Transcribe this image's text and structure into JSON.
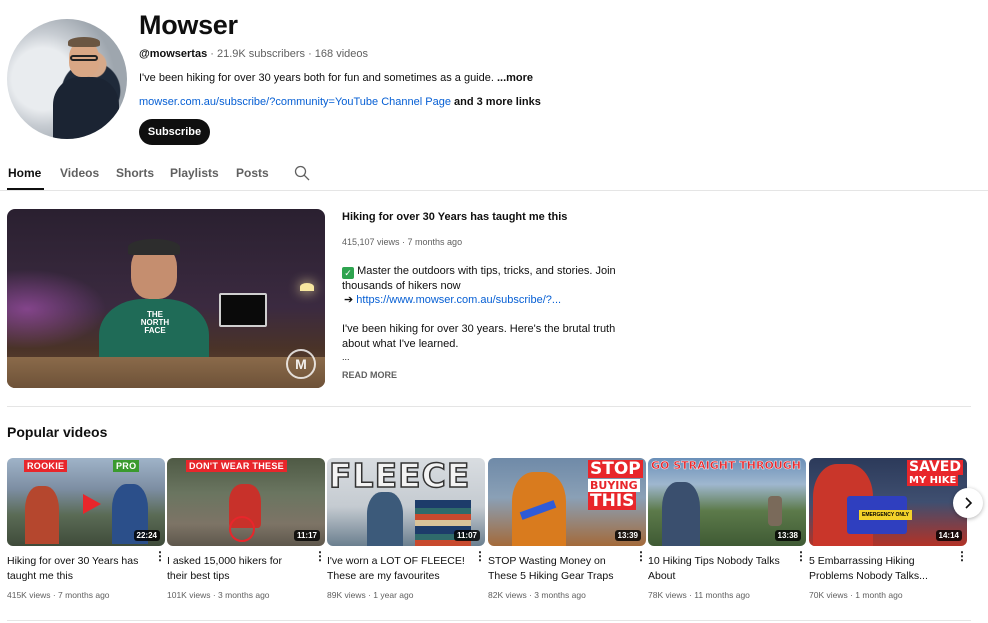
{
  "channel": {
    "name": "Mowser",
    "handle": "@mowsertas",
    "stats": "· 21.9K subscribers · 168 videos",
    "description": "I've been hiking for over 30 years both for fun and sometimes as a guide.",
    "more_label": "...more",
    "link": "mowser.com.au/subscribe/?community=YouTube Channel Page",
    "more_links": "and 3 more links",
    "subscribe_label": "Subscribe"
  },
  "tabs": [
    {
      "label": "Home",
      "active": true
    },
    {
      "label": "Videos"
    },
    {
      "label": "Shorts"
    },
    {
      "label": "Playlists"
    },
    {
      "label": "Posts"
    }
  ],
  "featured": {
    "title": "Hiking for over 30 Years has taught me this",
    "views": "415,107 views · 7 months ago",
    "desc_line1": "Master the outdoors with tips, tricks, and stories. Join thousands of hikers now",
    "arrow": "➔",
    "link": "https://www.mowser.com.au/subscribe/?...",
    "desc_line2": "I've been hiking for over 30 years. Here's the brutal truth about what I've learned.",
    "ellipsis": "...",
    "read_more": "READ MORE",
    "shirt_text": "THE NORTH FACE",
    "watermark": "M"
  },
  "popular": {
    "section_title": "Popular videos",
    "videos": [
      {
        "title": "Hiking for over 30 Years has taught me this",
        "meta": "415K views · 7 months ago",
        "duration": "22:24",
        "tag1": "ROOKIE",
        "tag2": "PRO"
      },
      {
        "title": "I asked 15,000 hikers for their best tips",
        "meta": "101K views · 3 months ago",
        "duration": "11:17",
        "tag1": "DON'T WEAR THESE"
      },
      {
        "title": "I've worn a LOT OF FLEECE! These are my favourites",
        "meta": "89K views · 1 year ago",
        "duration": "11:07",
        "tag1": "FLEECE"
      },
      {
        "title": "STOP Wasting Money on These 5 Hiking Gear Traps",
        "meta": "82K views · 3 months ago",
        "duration": "13:39",
        "tag1": "STOP",
        "tag2": "BUYING",
        "tag3": "THIS"
      },
      {
        "title": "10 Hiking Tips Nobody Talks About",
        "meta": "78K views · 11 months ago",
        "duration": "13:38",
        "tag1": "GO STRAIGHT THROUGH"
      },
      {
        "title": "5 Embarrassing Hiking Problems Nobody Talks...",
        "meta": "70K views · 1 month ago",
        "duration": "14:14",
        "tag1": "SAVED",
        "tag2": "MY HIKE",
        "tag3": "EMERGENCY ONLY"
      }
    ]
  },
  "menu_glyph": "⋮",
  "icons": {
    "search": "search-icon",
    "next": "chevron-right-icon"
  },
  "colors": {
    "link": "#065fd4",
    "text": "#0f0f0f",
    "secondary": "#606060",
    "accent_red": "#e8262b"
  }
}
